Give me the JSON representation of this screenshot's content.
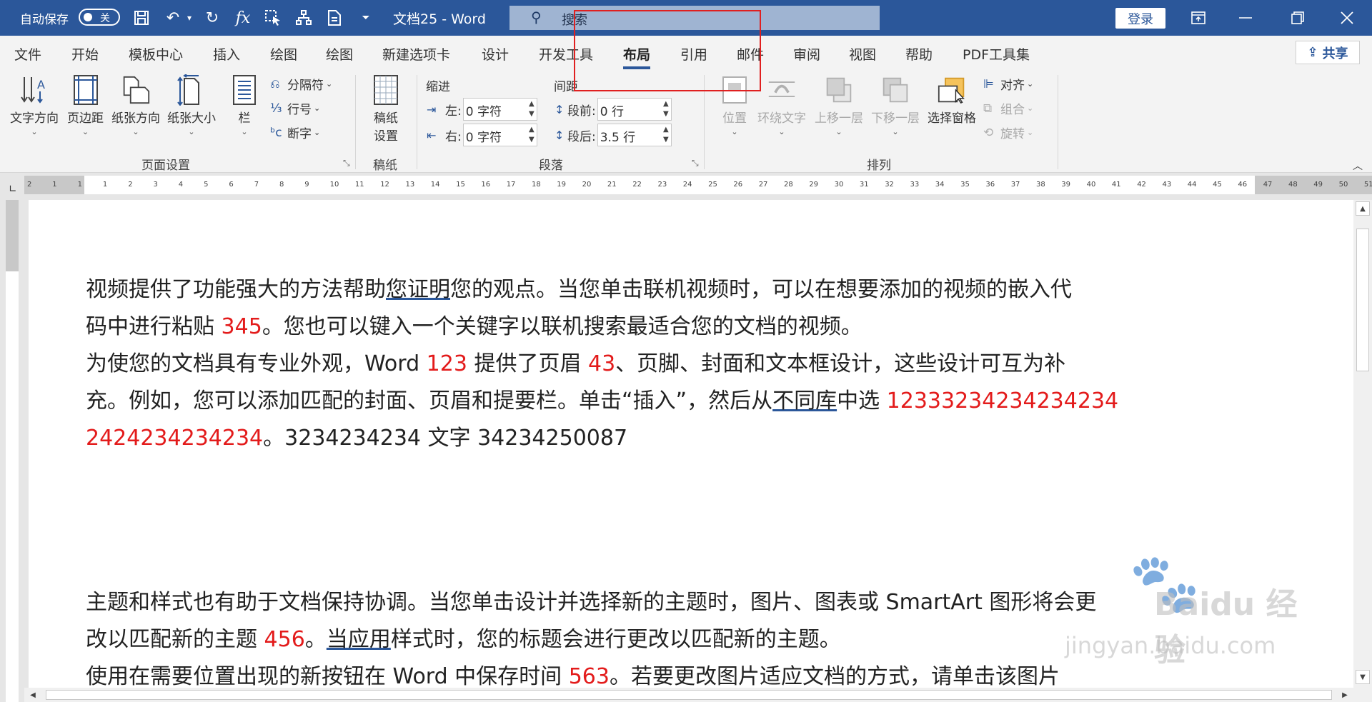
{
  "titlebar": {
    "autosave_label": "自动保存",
    "autosave_state": "关",
    "doc_title": "文档25  -  Word",
    "search_placeholder": "搜索",
    "login_label": "登录",
    "qa_icons": [
      "save-icon",
      "undo-icon",
      "redo-icon",
      "function-icon",
      "select-icon",
      "structure-icon",
      "document-icon",
      "customize-icon"
    ]
  },
  "tabs": [
    {
      "label": "文件"
    },
    {
      "label": "开始"
    },
    {
      "label": "模板中心"
    },
    {
      "label": "插入"
    },
    {
      "label": "绘图"
    },
    {
      "label": "绘图"
    },
    {
      "label": "新建选项卡"
    },
    {
      "label": "设计"
    },
    {
      "label": "开发工具"
    },
    {
      "label": "布局"
    },
    {
      "label": "引用"
    },
    {
      "label": "邮件"
    },
    {
      "label": "审阅"
    },
    {
      "label": "视图"
    },
    {
      "label": "帮助"
    },
    {
      "label": "PDF工具集"
    }
  ],
  "active_tab": "布局",
  "share_label": "共享",
  "ribbon": {
    "page_setup": {
      "label": "页面设置",
      "text_direction": "文字方向",
      "margins": "页边距",
      "orientation": "纸张方向",
      "size": "纸张大小",
      "columns": "栏",
      "breaks": "分隔符",
      "line_numbers": "行号",
      "hyphenation": "断字"
    },
    "manuscript": {
      "label": "稿纸",
      "settings": "稿纸\n设置",
      "settings_line1": "稿纸",
      "settings_line2": "设置"
    },
    "paragraph": {
      "label": "段落",
      "indent_header": "缩进",
      "spacing_header": "间距",
      "left_label": "左:",
      "left_value": "0 字符",
      "right_label": "右:",
      "right_value": "0 字符",
      "before_label": "段前:",
      "before_value": "0 行",
      "after_label": "段后:",
      "after_value": "3.5 行"
    },
    "arrange": {
      "label": "排列",
      "position": "位置",
      "wrap_text": "环绕文字",
      "bring_forward": "上移一层",
      "send_backward": "下移一层",
      "selection_pane": "选择窗格",
      "align": "对齐",
      "group": "组合",
      "rotate": "旋转"
    }
  },
  "ruler": {
    "numbers": [
      "2",
      "1",
      "1",
      "1",
      "2",
      "3",
      "4",
      "5",
      "6",
      "7",
      "8",
      "9",
      "10",
      "11",
      "12",
      "13",
      "14",
      "15",
      "16",
      "17",
      "18",
      "19",
      "20",
      "21",
      "22",
      "23",
      "24",
      "25",
      "26",
      "27",
      "28",
      "29",
      "30",
      "31",
      "32",
      "33",
      "34",
      "35",
      "36",
      "37",
      "38",
      "39",
      "40",
      "41",
      "42",
      "43",
      "44",
      "45",
      "46",
      "47",
      "48",
      "49",
      "50",
      "51"
    ]
  },
  "document": {
    "p1_a": "视频提供了功能强大的方法帮助",
    "p1_b": "您证明",
    "p1_c": "您的观点。当您单击联机视频时，可以在想要添加的视频的嵌入代",
    "p1_d": "码中进行粘贴 ",
    "p1_num": "345",
    "p1_e": "。您也可以键入一个关键字以联机搜索最适合您的文档的视频。",
    "p2_a": "为使您的文档具有专业外观，Word ",
    "p2_num1": "123",
    "p2_b": " 提供了页眉 ",
    "p2_num2": "43",
    "p2_c": "、页脚、封面和文本框设计，这些设计可互为补",
    "p2_d": "充。例如，您可以添加匹配的封面、页眉和提要栏。单击“插入”，然后从",
    "p2_e": "不同库",
    "p2_f": "中选 ",
    "p2_num3": "12333234234234234",
    "p2_num4": "2424234234234",
    "p2_g": "。3234234234 文字 34234250087",
    "p3_a": "主题和样式也有助于文档保持协调。当您单击设计并选择新的主题时，图片、图表或 SmartArt 图形将会更",
    "p3_b": "改以匹配新的主题 ",
    "p3_num": "456",
    "p3_c": "。",
    "p3_d": "当应用",
    "p3_e": "样式时，您的标题会进行更改以匹配新的主题。",
    "p4_a": "使用在需要位置出现的新按钮在 Word 中保存时间 ",
    "p4_num": "563",
    "p4_b": "。若要更改图片适应文档的方式，请单击该图片"
  },
  "watermark": {
    "line1": "Baidu 经验",
    "line2": "jingyan.baidu.com"
  },
  "colors": {
    "title_bar": "#2b579a",
    "highlight_box": "#e02020",
    "red_text": "#e31b1b"
  }
}
